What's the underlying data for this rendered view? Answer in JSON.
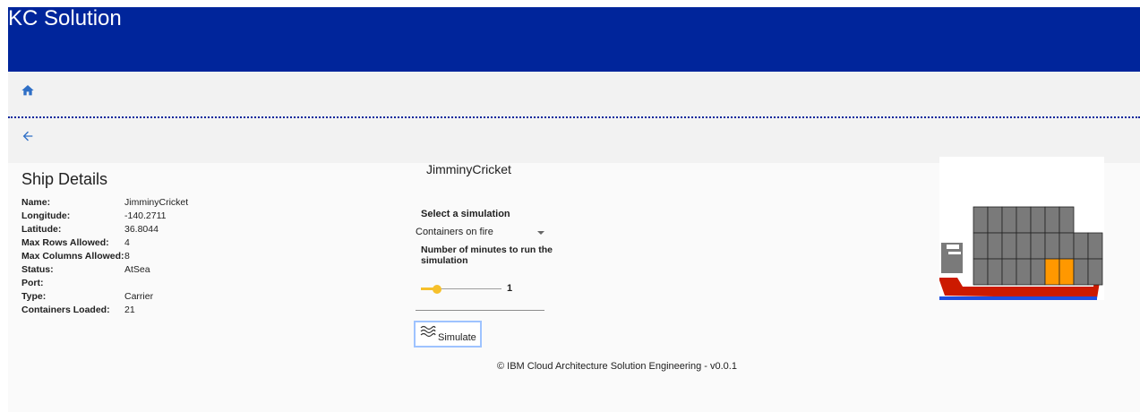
{
  "header": {
    "title": "KC Solution",
    "bg_color": "#00259b"
  },
  "nav": {
    "home_icon": "home-icon",
    "back_icon": "arrow-left-icon",
    "icon_color": "#2f6fc6"
  },
  "details": {
    "title": "Ship Details",
    "rows": [
      {
        "label": "Name:",
        "value": "JimminyCricket"
      },
      {
        "label": "Longitude:",
        "value": "-140.2711"
      },
      {
        "label": "Latitude:",
        "value": "36.8044"
      },
      {
        "label": "Max Rows Allowed:",
        "value": "4"
      },
      {
        "label": "Max Columns Allowed:",
        "value": "8"
      },
      {
        "label": "Status:",
        "value": "AtSea"
      },
      {
        "label": "Port:",
        "value": ""
      },
      {
        "label": "Type:",
        "value": "Carrier"
      },
      {
        "label": "Containers Loaded:",
        "value": "21"
      }
    ]
  },
  "simulation": {
    "ship_name": "JimminyCricket",
    "select_title": "Select a simulation",
    "selected": "Containers on fire",
    "minutes_title": "Number of minutes to run the simulation",
    "minutes_value": "1",
    "slider_fraction": 0.2,
    "slider_color": "#f6c02b",
    "button_label": "Simulate",
    "button_icon": "waves-icon"
  },
  "ship_visual": {
    "hull_color": "#cc1a00",
    "water_color": "#1f4fe0",
    "container_color": "#7a7a7a",
    "fire_color": "#ff9800"
  },
  "footer": {
    "text": "© IBM Cloud Architecture Solution Engineering - v0.0.1"
  }
}
